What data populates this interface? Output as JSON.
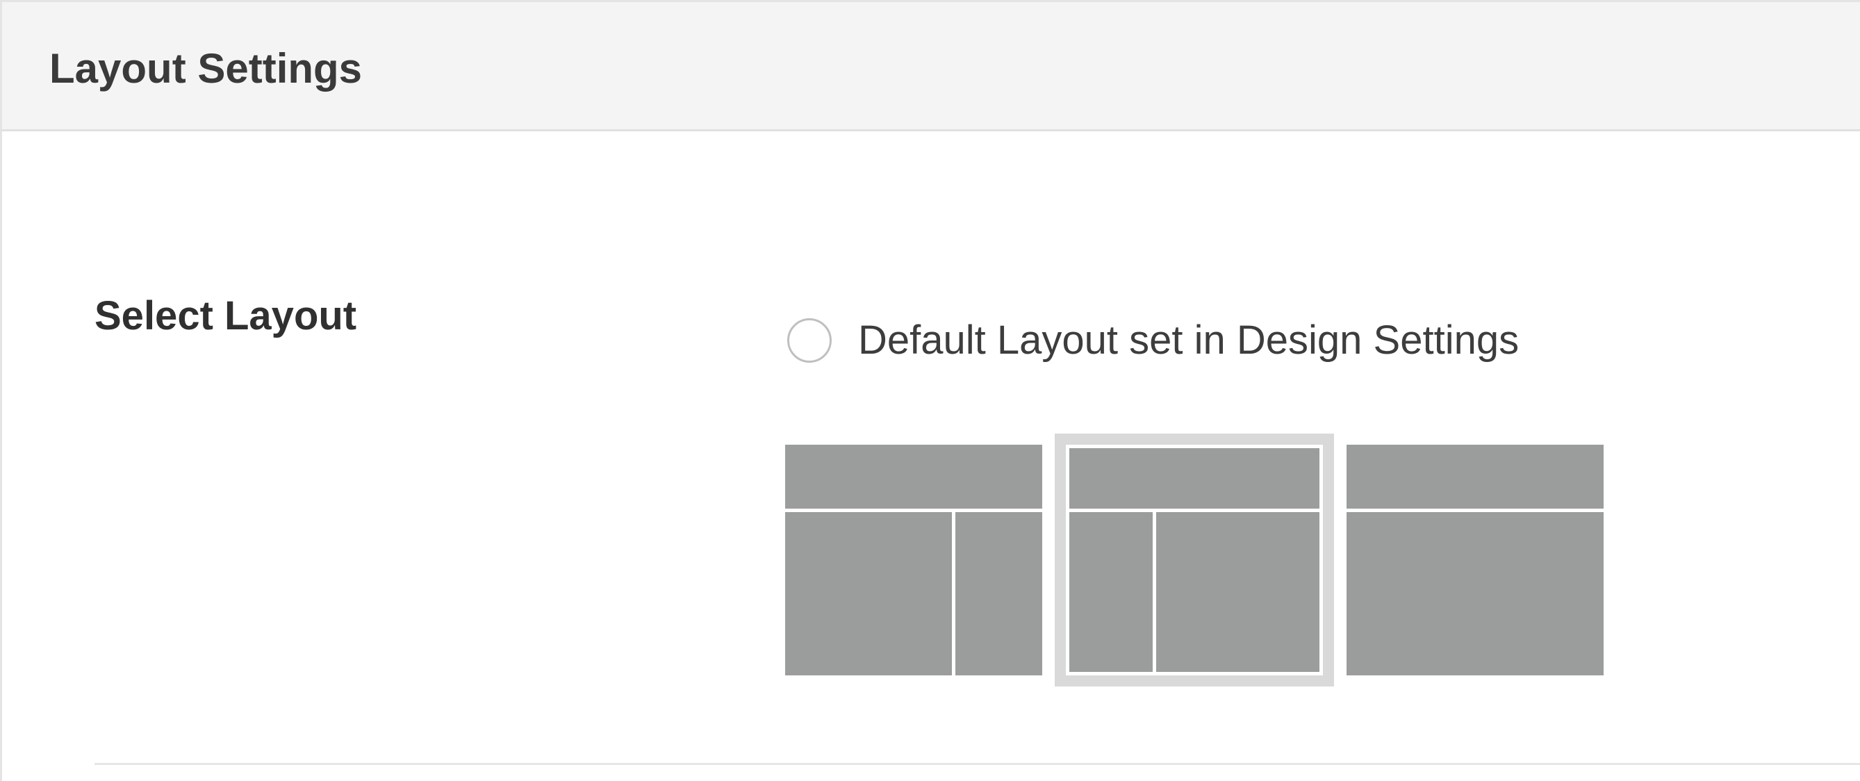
{
  "panel": {
    "title": "Layout Settings"
  },
  "layout_field": {
    "label": "Select Layout",
    "default_option_label": "Default Layout set in Design Settings",
    "default_option_checked": false,
    "options": [
      {
        "name": "header-content-right-sidebar",
        "icon": "layout-content-left-sidebar-right-icon",
        "selected": false
      },
      {
        "name": "header-left-sidebar-content",
        "icon": "layout-sidebar-left-content-right-icon",
        "selected": true
      },
      {
        "name": "header-full-width",
        "icon": "layout-full-width-icon",
        "selected": false
      }
    ]
  },
  "colors": {
    "block_fill": "#9b9d9c",
    "block_gap": "#ffffff",
    "selected_border": "#d9d9d9",
    "header_bg": "#f4f4f4"
  }
}
